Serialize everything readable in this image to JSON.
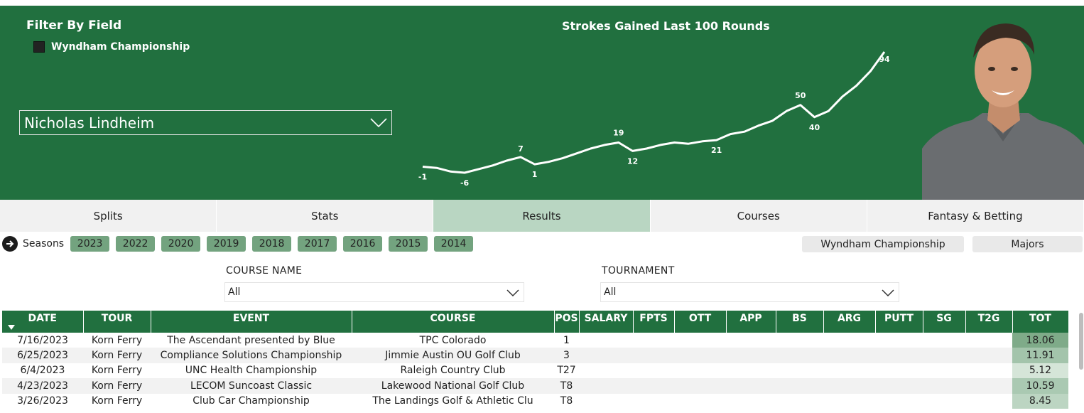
{
  "header": {
    "filter_title": "Filter By Field",
    "filter_option": "Wyndham Championship",
    "player": "Nicholas Lindheim",
    "chart_title": "Strokes Gained Last 100 Rounds",
    "accent_color": "#21703f"
  },
  "chart_data": {
    "type": "line",
    "title": "Strokes Gained Last 100 Rounds",
    "labels": [
      {
        "text": "-1",
        "value": -1
      },
      {
        "text": "-6",
        "value": -6
      },
      {
        "text": "7",
        "value": 7
      },
      {
        "text": "1",
        "value": 1
      },
      {
        "text": "19",
        "value": 19
      },
      {
        "text": "12",
        "value": 12
      },
      {
        "text": "21",
        "value": 21
      },
      {
        "text": "50",
        "value": 50
      },
      {
        "text": "40",
        "value": 40
      },
      {
        "text": "94",
        "value": 94
      }
    ],
    "x": [
      1,
      4,
      7,
      10,
      13,
      16,
      19,
      22,
      25,
      28,
      31,
      34,
      37,
      40,
      43,
      46,
      49,
      52,
      55,
      58,
      61,
      64,
      67,
      70,
      73,
      76,
      79,
      82,
      85,
      88,
      91,
      94,
      97,
      100
    ],
    "y": [
      -1,
      -2,
      -5,
      -6,
      -3,
      0,
      4,
      7,
      1,
      3,
      6,
      10,
      14,
      17,
      19,
      12,
      14,
      17,
      19,
      18,
      20,
      21,
      26,
      28,
      33,
      37,
      45,
      50,
      40,
      45,
      57,
      66,
      78,
      94
    ],
    "line_color": "#ffffff",
    "grid": false
  },
  "tabs": [
    {
      "label": "Splits",
      "active": false
    },
    {
      "label": "Stats",
      "active": false
    },
    {
      "label": "Results",
      "active": true
    },
    {
      "label": "Courses",
      "active": false
    },
    {
      "label": "Fantasy & Betting",
      "active": false
    }
  ],
  "seasons": {
    "label": "Seasons",
    "years": [
      "2023",
      "2022",
      "2020",
      "2019",
      "2018",
      "2017",
      "2016",
      "2015",
      "2014"
    ]
  },
  "filters": {
    "wyndham": "Wyndham Championship",
    "majors": "Majors"
  },
  "slicers": {
    "course_label": "COURSE NAME",
    "course_value": "All",
    "tournament_label": "TOURNAMENT",
    "tournament_value": "All"
  },
  "table": {
    "columns": [
      "DATE",
      "TOUR",
      "EVENT",
      "COURSE",
      "POS",
      "SALARY",
      "FPTS",
      "OTT",
      "APP",
      "BS",
      "ARG",
      "PUTT",
      "SG",
      "T2G",
      "TOT"
    ],
    "rows": [
      {
        "date": "7/16/2023",
        "tour": "Korn Ferry",
        "event": "The Ascendant presented by Blue",
        "course": "TPC Colorado",
        "pos": "1",
        "tot": "18.06",
        "tot_color": "#7fab89"
      },
      {
        "date": "6/25/2023",
        "tour": "Korn Ferry",
        "event": "Compliance Solutions Championship",
        "course": "Jimmie Austin OU Golf Club",
        "pos": "3",
        "tot": "11.91",
        "tot_color": "#a3c4ab"
      },
      {
        "date": "6/4/2023",
        "tour": "Korn Ferry",
        "event": "UNC Health Championship",
        "course": "Raleigh Country Club",
        "pos": "T27",
        "tot": "5.12",
        "tot_color": "#d5e5d8"
      },
      {
        "date": "4/23/2023",
        "tour": "Korn Ferry",
        "event": "LECOM Suncoast Classic",
        "course": "Lakewood National Golf Club",
        "pos": "T8",
        "tot": "10.59",
        "tot_color": "#aac9b2"
      },
      {
        "date": "3/26/2023",
        "tour": "Korn Ferry",
        "event": "Club Car Championship",
        "course": "The Landings Golf & Athletic Clu",
        "pos": "T8",
        "tot": "8.45",
        "tot_color": "#bcd5c2"
      }
    ]
  }
}
